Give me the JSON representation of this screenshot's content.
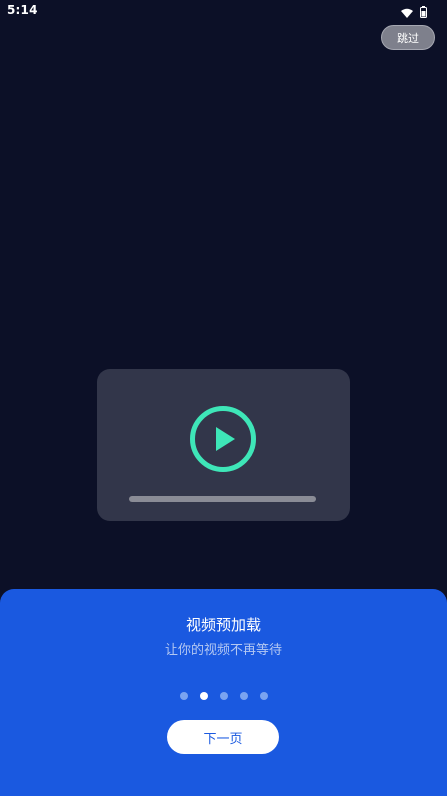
{
  "status_bar": {
    "time": "5:14",
    "icons": [
      "wifi-icon",
      "battery-icon"
    ]
  },
  "skip_button": {
    "label": "跳过"
  },
  "video_card": {
    "icon": "play-icon",
    "accent_color": "#3ee6b8"
  },
  "panel": {
    "title": "视频预加载",
    "subtitle": "让你的视频不再等待",
    "page_count": 5,
    "active_page": 2,
    "next_button": {
      "label": "下一页"
    },
    "background_color": "#1a59e0"
  }
}
